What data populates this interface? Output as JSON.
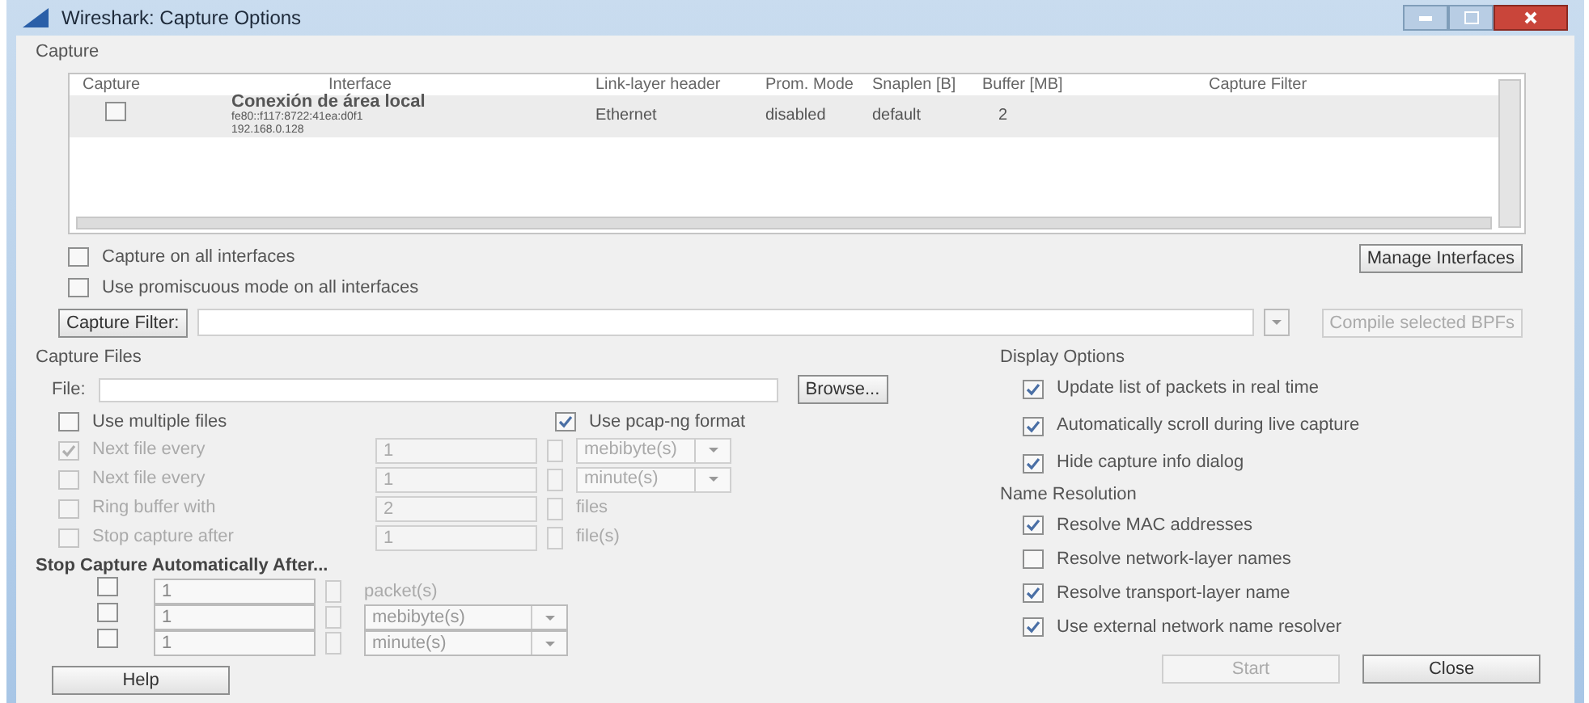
{
  "window": {
    "title": "Wireshark: Capture Options"
  },
  "capture": {
    "heading": "Capture",
    "columns": [
      "Capture",
      "Interface",
      "Link-layer header",
      "Prom. Mode",
      "Snaplen [B]",
      "Buffer [MB]",
      "Capture Filter"
    ],
    "rows": [
      {
        "checked": false,
        "name": "Conexión de área local",
        "address_1": "fe80::f117:8722:41ea:d0f1",
        "address_2": "192.168.0.128",
        "link": "Ethernet",
        "prom": "disabled",
        "snaplen": "default",
        "buffer": "2",
        "filter": ""
      }
    ],
    "options": [
      {
        "label": "Capture on all interfaces",
        "checked": false
      },
      {
        "label": "Use promiscuous mode on all interfaces",
        "checked": false
      }
    ],
    "manage_button": "Manage Interfaces",
    "filter_button": "Capture Filter:",
    "compile_button": {
      "label": "Compile selected BPFs",
      "disabled": true
    }
  },
  "capture_files": {
    "heading": "Capture Files",
    "file_label": "File:",
    "browse_button": "Browse...",
    "multiple": {
      "label": "Use multiple files",
      "checked": false
    },
    "pcapng": {
      "label": "Use pcap-ng format",
      "checked": true
    },
    "rows": [
      {
        "label": "Next file every",
        "checked": true,
        "disabled": true,
        "value": "1",
        "unit": "mebibyte(s)",
        "kind": "dropdown"
      },
      {
        "label": "Next file every",
        "checked": false,
        "disabled": true,
        "value": "1",
        "unit": "minute(s)",
        "kind": "dropdown"
      },
      {
        "label": "Ring buffer with",
        "checked": false,
        "disabled": true,
        "value": "2",
        "unit": "files",
        "kind": "text"
      },
      {
        "label": "Stop capture after",
        "checked": false,
        "disabled": true,
        "value": "1",
        "unit": "file(s)",
        "kind": "text"
      }
    ]
  },
  "stop_capture": {
    "heading": "Stop Capture Automatically After...",
    "rows": [
      {
        "checked": false,
        "value": "1",
        "unit": "packet(s)",
        "kind": "text"
      },
      {
        "checked": false,
        "value": "1",
        "unit": "mebibyte(s)",
        "kind": "dropdown"
      },
      {
        "checked": false,
        "value": "1",
        "unit": "minute(s)",
        "kind": "dropdown"
      }
    ]
  },
  "display_options": {
    "heading": "Display Options",
    "items": [
      {
        "label": "Update list of packets in real time",
        "checked": true
      },
      {
        "label": "Automatically scroll during live capture",
        "checked": true
      },
      {
        "label": "Hide capture info dialog",
        "checked": true
      }
    ]
  },
  "name_resolution": {
    "heading": "Name Resolution",
    "items": [
      {
        "label": "Resolve MAC addresses",
        "checked": true
      },
      {
        "label": "Resolve network-layer names",
        "checked": false
      },
      {
        "label": "Resolve transport-layer name",
        "checked": true
      },
      {
        "label": "Use external network name resolver",
        "checked": true
      }
    ]
  },
  "buttons": {
    "help": "Help",
    "start": {
      "label": "Start",
      "disabled": true
    },
    "close": "Close"
  }
}
